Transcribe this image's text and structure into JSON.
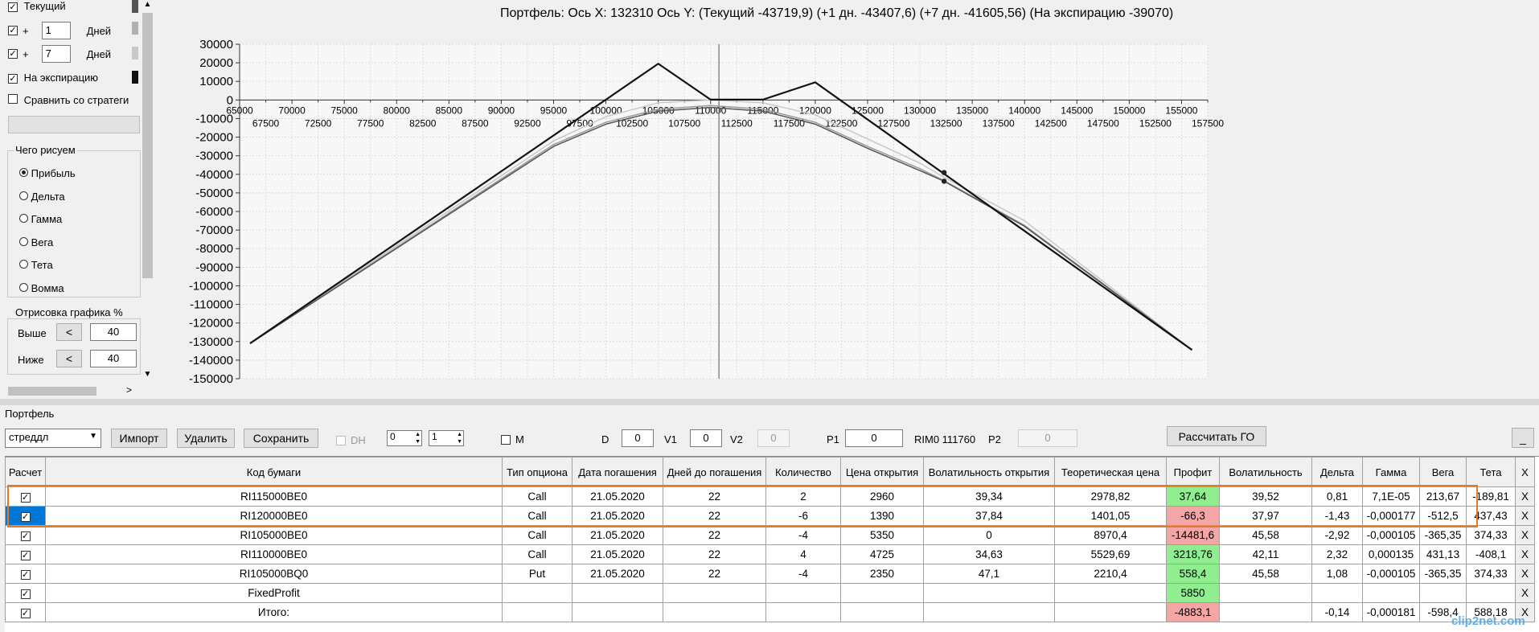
{
  "left_panel": {
    "checks": [
      {
        "label": "Текущий",
        "checked": true,
        "color": "#555555"
      },
      {
        "prefix": "+",
        "value": "1",
        "unit": "Дней",
        "checked": true,
        "color": "#b0b0b0"
      },
      {
        "prefix": "+",
        "value": "7",
        "unit": "Дней",
        "checked": true,
        "color": "#c8c8c8"
      },
      {
        "label": "На экспирацию",
        "checked": true,
        "color": "#111111"
      }
    ],
    "compare_label": "Сравнить со стратеги",
    "draw_group": {
      "title": "Чего рисуем",
      "options": [
        "Прибыль",
        "Дельта",
        "Гамма",
        "Вега",
        "Тета",
        "Вомма"
      ],
      "selected": "Прибыль"
    },
    "plot_group": {
      "title": "Отрисовка графика %",
      "above_label": "Выше",
      "above_btn": "<",
      "above_value": "40",
      "below_label": "Ниже",
      "below_btn": "<",
      "below_value": "40"
    },
    "scroll_left": "<",
    "scroll_right": ">",
    "scroll_up": "^",
    "scroll_down": "v"
  },
  "chart": {
    "title": "Портфель: Ось X: 132310 Ось Y:  (Текущий -43719,9)  (+1 дн. -43407,6)  (+7 дн. -41605,56)  (На экспирацию -39070)"
  },
  "chart_data": {
    "type": "line",
    "x_ticks_top": [
      65000,
      70000,
      75000,
      80000,
      85000,
      90000,
      95000,
      100000,
      105000,
      110000,
      115000,
      120000,
      125000,
      130000,
      135000,
      140000,
      145000,
      150000,
      155000
    ],
    "x_ticks_bottom": [
      67500,
      72500,
      77500,
      82500,
      87500,
      92500,
      97500,
      102500,
      107500,
      112500,
      117500,
      122500,
      127500,
      132500,
      137500,
      142500,
      147500,
      152500,
      157500
    ],
    "y_ticks": [
      30000,
      20000,
      10000,
      0,
      -10000,
      -20000,
      -30000,
      -40000,
      -50000,
      -60000,
      -70000,
      -80000,
      -90000,
      -100000,
      -110000,
      -120000,
      -130000,
      -140000,
      -150000
    ],
    "xlim": [
      65000,
      157500
    ],
    "ylim": [
      -150000,
      30000
    ],
    "cursor_x": 110800,
    "series": [
      {
        "color": "#111111",
        "x": [
          66000,
          105000,
          110000,
          115000,
          120000,
          156000
        ],
        "y": [
          -131000,
          19500,
          200,
          200,
          9500,
          -134500
        ]
      },
      {
        "color": "#555555",
        "x": [
          66000,
          95000,
          100000,
          105000,
          110000,
          115000,
          120000,
          125000,
          130000,
          132310,
          140000,
          156000
        ],
        "y": [
          -131000,
          -25000,
          -13000,
          -6000,
          -4000,
          -6000,
          -13000,
          -26000,
          -38000,
          -43719.9,
          -68000,
          -134500
        ]
      },
      {
        "color": "#999999",
        "x": [
          66000,
          95000,
          100000,
          105000,
          110000,
          115000,
          120000,
          125000,
          130000,
          132310,
          140000,
          156000
        ],
        "y": [
          -131000,
          -24000,
          -12000,
          -5000,
          -3000,
          -5000,
          -12000,
          -25000,
          -37000,
          -43407.6,
          -67500,
          -134500
        ]
      },
      {
        "color": "#c8c8c8",
        "x": [
          66000,
          95000,
          100000,
          105000,
          110000,
          115000,
          120000,
          125000,
          130000,
          132310,
          140000,
          156000
        ],
        "y": [
          -131000,
          -22000,
          -9000,
          -1500,
          0,
          -1500,
          -8000,
          -21000,
          -34000,
          -41605.56,
          -65000,
          -134500
        ]
      }
    ],
    "markers": [
      {
        "x": 132310,
        "y": -39070
      },
      {
        "x": 132310,
        "y": -43719.9
      }
    ]
  },
  "portfolio": {
    "label": "Портфель",
    "strategy": "стреддл",
    "import_btn": "Импорт",
    "delete_btn": "Удалить",
    "save_btn": "Сохранить",
    "dh_label": "DH",
    "spin1": "0",
    "spin2": "1",
    "m_label": "M",
    "d_label": "D",
    "d_value": "0",
    "v1_label": "V1",
    "v1_value": "0",
    "v2_label": "V2",
    "v2_value": "0",
    "p1_label": "P1",
    "p1_value": "0",
    "rim_label": "RIM0 111760",
    "p2_label": "P2",
    "p2_value": "0",
    "calc_btn": "Рассчитать ГО",
    "min_btn": "_"
  },
  "table": {
    "headers": [
      "Расчет",
      "Код бумаги",
      "Тип опциона",
      "Дата погашения",
      "Дней до погашения",
      "Количество",
      "Цена открытия",
      "Волатильность открытия",
      "Теоретическая цена",
      "Профит",
      "Волатильность",
      "Дельта",
      "Гамма",
      "Вега",
      "Тета",
      "X"
    ],
    "rows": [
      {
        "code": "RI115000BE0",
        "type": "Call",
        "date": "21.05.2020",
        "days": "22",
        "qty": "2",
        "open": "2960",
        "vol_open": "39,34",
        "theo": "2978,82",
        "profit": "37,64",
        "vol": "39,52",
        "delta": "0,81",
        "gamma": "7,1E-05",
        "vega": "213,67",
        "theta": "-189,81",
        "x": "X"
      },
      {
        "code": "RI120000BE0",
        "type": "Call",
        "date": "21.05.2020",
        "days": "22",
        "qty": "-6",
        "open": "1390",
        "vol_open": "37,84",
        "theo": "1401,05",
        "profit": "-66,3",
        "vol": "37,97",
        "delta": "-1,43",
        "gamma": "-0,000177",
        "vega": "-512,5",
        "theta": "437,43",
        "x": "X"
      },
      {
        "code": "RI105000BE0",
        "type": "Call",
        "date": "21.05.2020",
        "days": "22",
        "qty": "-4",
        "open": "5350",
        "vol_open": "0",
        "theo": "8970,4",
        "profit": "-14481,6",
        "vol": "45,58",
        "delta": "-2,92",
        "gamma": "-0,000105",
        "vega": "-365,35",
        "theta": "374,33",
        "x": "X"
      },
      {
        "code": "RI110000BE0",
        "type": "Call",
        "date": "21.05.2020",
        "days": "22",
        "qty": "4",
        "open": "4725",
        "vol_open": "34,63",
        "theo": "5529,69",
        "profit": "3218,76",
        "vol": "42,11",
        "delta": "2,32",
        "gamma": "0,000135",
        "vega": "431,13",
        "theta": "-408,1",
        "x": "X"
      },
      {
        "code": "RI105000BQ0",
        "type": "Put",
        "date": "21.05.2020",
        "days": "22",
        "qty": "-4",
        "open": "2350",
        "vol_open": "47,1",
        "theo": "2210,4",
        "profit": "558,4",
        "vol": "45,58",
        "delta": "1,08",
        "gamma": "-0,000105",
        "vega": "-365,35",
        "theta": "374,33",
        "x": "X"
      },
      {
        "code": "FixedProfit",
        "type": "",
        "date": "",
        "days": "",
        "qty": "",
        "open": "",
        "vol_open": "",
        "theo": "",
        "profit": "5850",
        "vol": "",
        "delta": "",
        "gamma": "",
        "vega": "",
        "theta": "",
        "x": "X"
      },
      {
        "code": "Итого:",
        "type": "",
        "date": "",
        "days": "",
        "qty": "",
        "open": "",
        "vol_open": "",
        "theo": "",
        "profit": "-4883,1",
        "vol": "",
        "delta": "-0,14",
        "gamma": "-0,000181",
        "vega": "-598,4",
        "theta": "588,18",
        "x": "X"
      }
    ]
  },
  "watermark": "clip2net.com"
}
